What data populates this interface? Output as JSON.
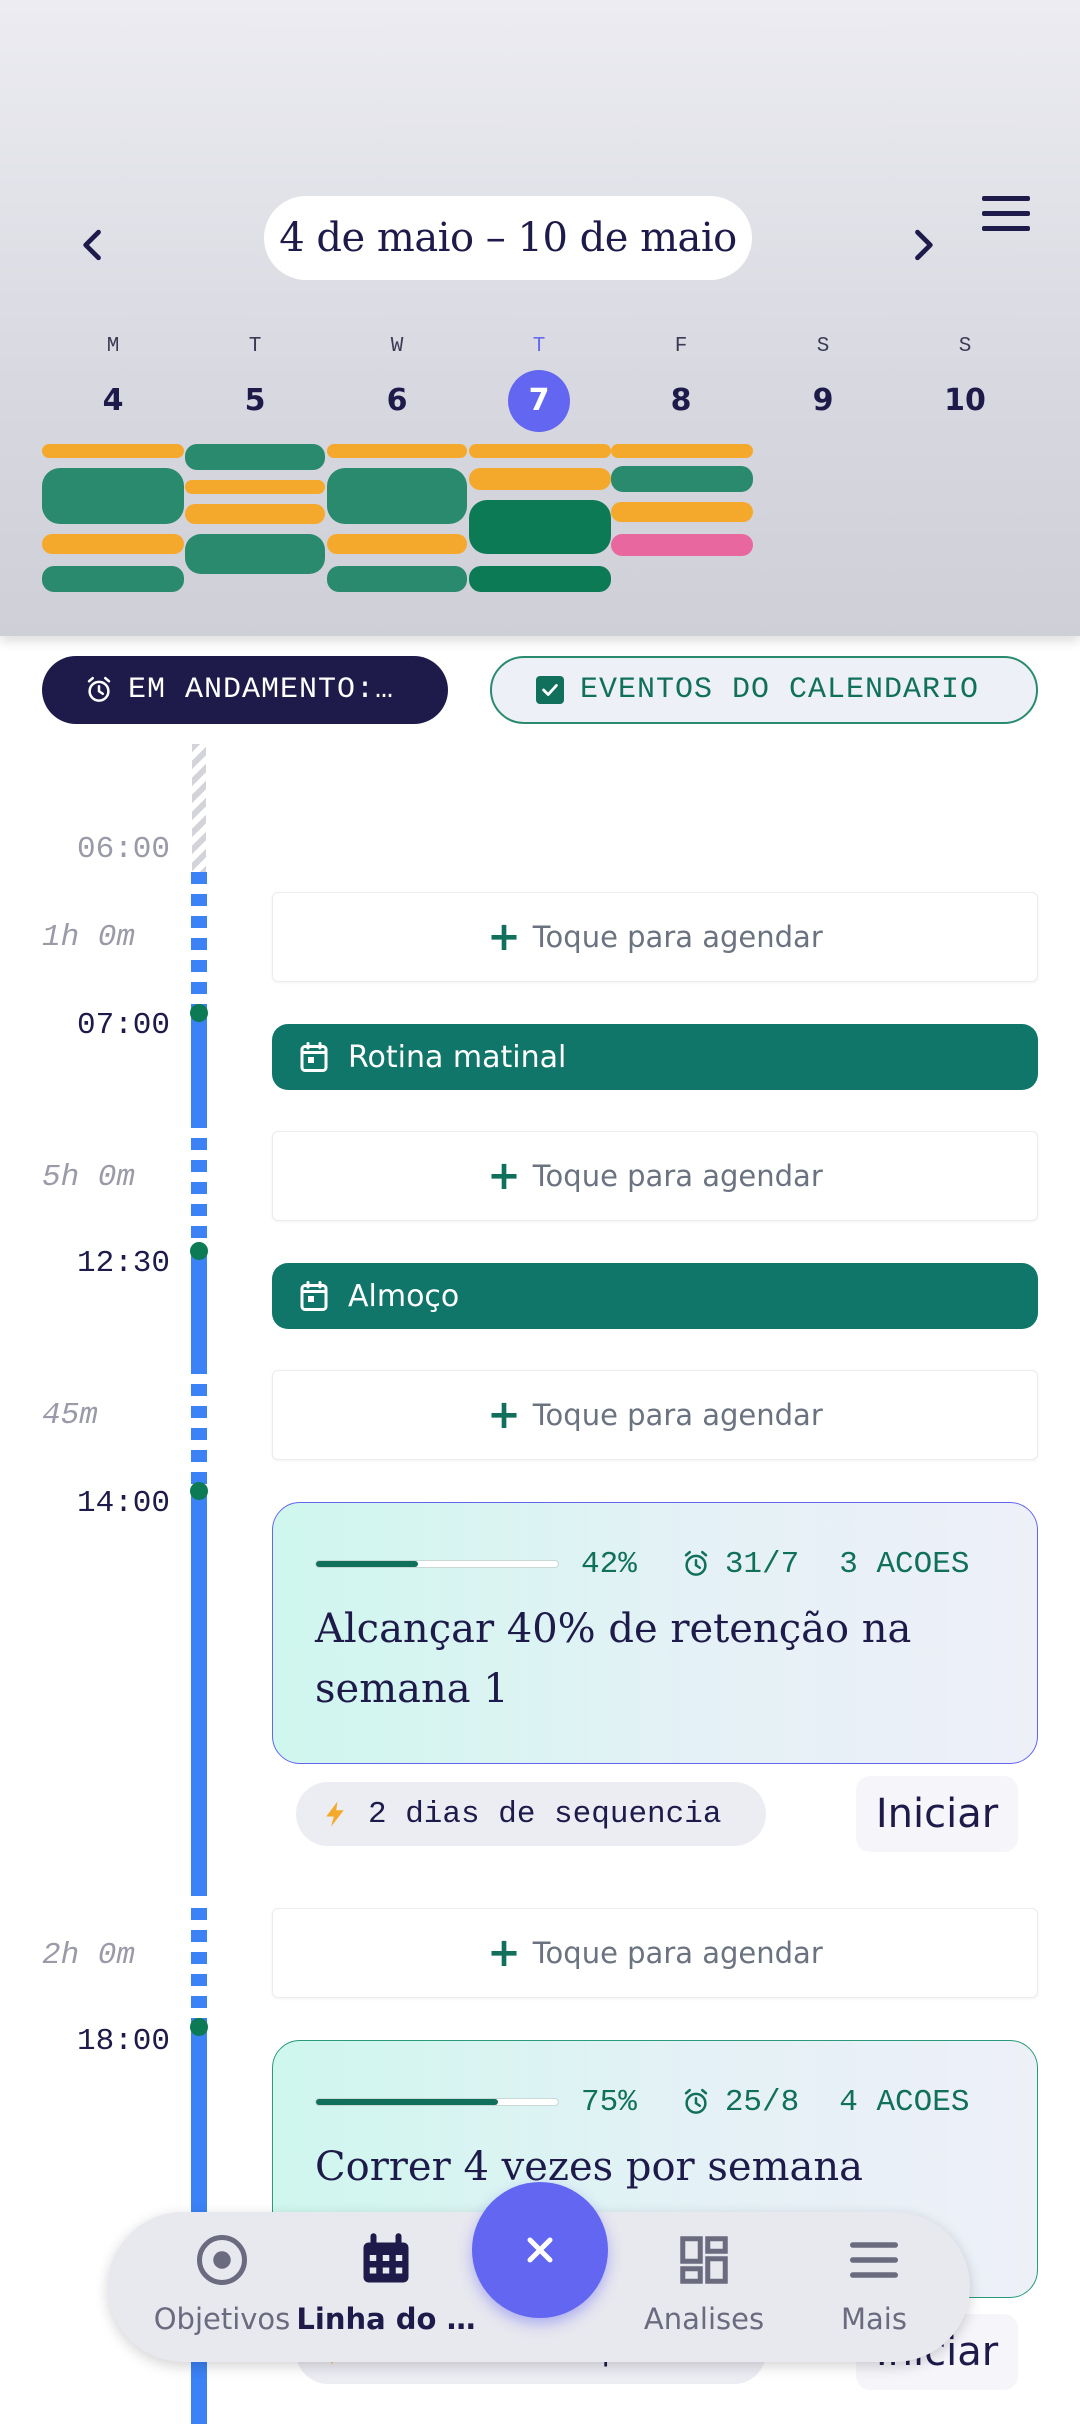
{
  "header": {
    "week_range": "4 de maio – 10 de maio",
    "days": [
      {
        "letter": "M",
        "num": "4"
      },
      {
        "letter": "T",
        "num": "5"
      },
      {
        "letter": "W",
        "num": "6"
      },
      {
        "letter": "T",
        "num": "7"
      },
      {
        "letter": "F",
        "num": "8"
      },
      {
        "letter": "S",
        "num": "9"
      },
      {
        "letter": "S",
        "num": "10"
      }
    ],
    "selected_day": "7"
  },
  "filters": {
    "running_label": "EM ANDAMENTO:…",
    "calendar_label": "EVENTOS DO CALENDARIO"
  },
  "timeline": {
    "times": [
      "06:00",
      "07:00",
      "12:30",
      "14:00",
      "18:00"
    ],
    "gaps": [
      "1h 0m",
      "5h 0m",
      "45m",
      "2h 0m"
    ],
    "schedule_label": "Toque para agendar",
    "events": [
      "Rotina matinal",
      "Almoço"
    ],
    "goals": [
      {
        "progress_pct": 42,
        "progress_label": "42%",
        "due": "31/7",
        "actions": "3 ACOES",
        "title": "Alcançar 40% de retenção na semana 1",
        "streak": "2 dias de sequencia",
        "start": "Iniciar"
      },
      {
        "progress_pct": 75,
        "progress_label": "75%",
        "due": "25/8",
        "actions": "4 ACOES",
        "title": "Correr 4 vezes por semana",
        "streak": "2 dias de sequencia",
        "start": "Iniciar"
      }
    ]
  },
  "bottom_nav": {
    "items": [
      "Objetivos",
      "Linha do …",
      "Analises",
      "Mais"
    ],
    "fab_icon": "close-icon",
    "active": "Linha do …"
  },
  "colors": {
    "accent": "#6366f1",
    "teal": "#11766a",
    "timeline_blue": "#3b82f6",
    "bar_yellow": "#f5a92c",
    "bar_green": "#2a8a6e",
    "bar_pink": "#e9679f"
  }
}
